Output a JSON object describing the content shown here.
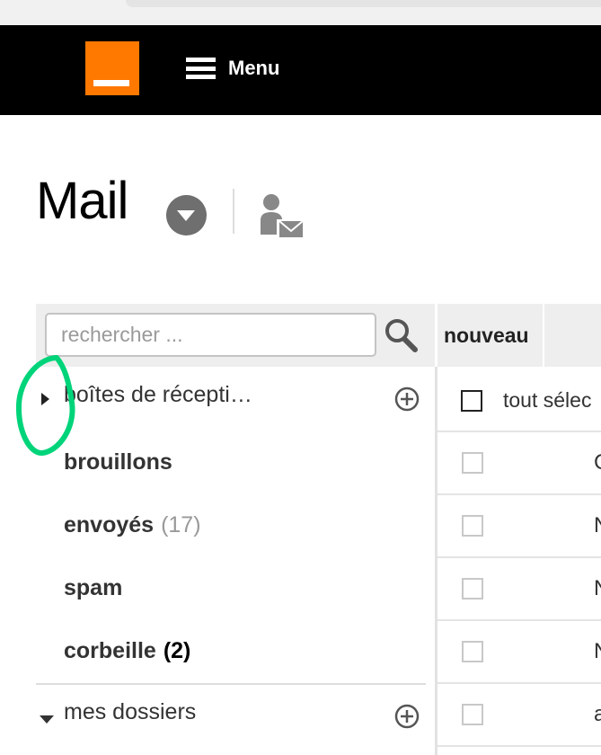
{
  "header": {
    "logo": "orange-logo",
    "menu_label": "Menu",
    "colors": {
      "brand": "#ff7900",
      "bar": "#000000"
    }
  },
  "page": {
    "title": "Mail"
  },
  "search": {
    "placeholder": "rechercher ..."
  },
  "folders": [
    {
      "label": "boîtes de récepti…",
      "count": "",
      "icon": "triangle-right-icon"
    },
    {
      "label": "brouillons",
      "count": ""
    },
    {
      "label": "envoyés",
      "count": "(17)"
    },
    {
      "label": "spam",
      "count": ""
    },
    {
      "label": "corbeille",
      "count": "(2)"
    }
  ],
  "my_folders": {
    "label": "mes dossiers",
    "icon": "triangle-down-icon"
  },
  "toolbar": {
    "new_label": "nouveau"
  },
  "messages": {
    "select_all_label": "tout sélec",
    "rows": [
      {
        "snippet": "C"
      },
      {
        "snippet": "N"
      },
      {
        "snippet": "N"
      },
      {
        "snippet": "N"
      },
      {
        "snippet": "a"
      }
    ]
  },
  "annotation": {
    "color": "#00d47a"
  }
}
